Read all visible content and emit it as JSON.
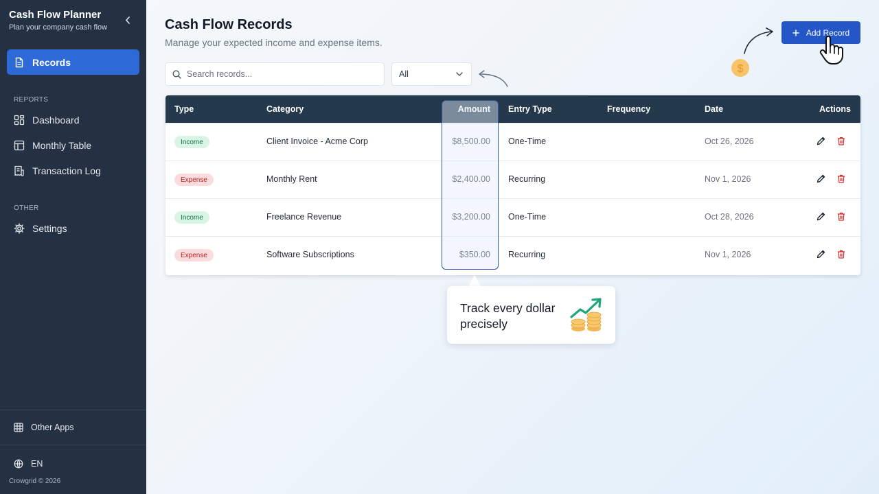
{
  "sidebar": {
    "title": "Cash Flow Planner",
    "subtitle": "Plan your company cash flow",
    "collapse_icon": "chevron-left-icon",
    "primary": {
      "label": "Records",
      "icon": "document-icon"
    },
    "reports_heading": "REPORTS",
    "reports": [
      {
        "label": "Dashboard",
        "icon": "dashboard-icon"
      },
      {
        "label": "Monthly Table",
        "icon": "table-icon"
      },
      {
        "label": "Transaction Log",
        "icon": "receipt-icon"
      }
    ],
    "other_heading": "OTHER",
    "settings": {
      "label": "Settings",
      "icon": "gear-icon"
    },
    "other_apps": {
      "label": "Other Apps",
      "icon": "grid-icon"
    },
    "language": {
      "label": "EN",
      "icon": "globe-icon"
    },
    "footer": "Crowgrid © 2026"
  },
  "header": {
    "title": "Cash Flow Records",
    "subtitle": "Manage your expected income and expense items."
  },
  "toolbar": {
    "add_label": "Add Record",
    "search_placeholder": "Search records...",
    "filter_value": "All"
  },
  "table": {
    "columns": [
      "Type",
      "Category",
      "Amount",
      "Entry Type",
      "Frequency",
      "Date",
      "Actions"
    ],
    "rows": [
      {
        "type": "Income",
        "category": "Client Invoice - Acme Corp",
        "amount": "$8,500.00",
        "entry_type": "One-Time",
        "frequency": "",
        "date": "Oct 26, 2026"
      },
      {
        "type": "Expense",
        "category": "Monthly Rent",
        "amount": "$2,400.00",
        "entry_type": "Recurring",
        "frequency": "",
        "date": "Nov 1, 2026"
      },
      {
        "type": "Income",
        "category": "Freelance Revenue",
        "amount": "$3,200.00",
        "entry_type": "One-Time",
        "frequency": "",
        "date": "Oct 28, 2026"
      },
      {
        "type": "Expense",
        "category": "Software Subscriptions",
        "amount": "$350.00",
        "entry_type": "Recurring",
        "frequency": "",
        "date": "Nov 1, 2026"
      }
    ]
  },
  "callout": {
    "text": "Track every dollar precisely",
    "icon": "coins-growth-icon"
  },
  "colors": {
    "sidebar_bg": "#243142",
    "active_item": "#2d6ad8",
    "primary_button": "#2456c8",
    "table_header": "#243a4c",
    "income_badge": "#d9f5e6",
    "expense_badge": "#fadcdc"
  }
}
